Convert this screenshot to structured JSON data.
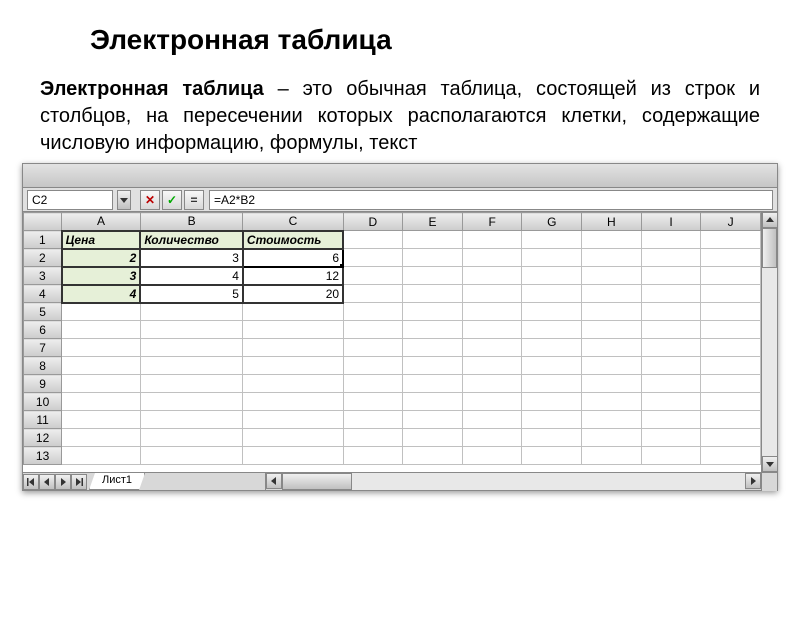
{
  "title": "Электронная таблица",
  "intro_bold": "Электронная таблица",
  "intro_rest": " – это обычная таблица, состоящей из строк и столбцов, на пересечении которых располагаются клетки, содержащие числовую информацию, формулы, текст",
  "formula_bar": {
    "cell_ref": "C2",
    "formula": "=A2*B2"
  },
  "columns": [
    "A",
    "B",
    "C",
    "D",
    "E",
    "F",
    "G",
    "H",
    "I",
    "J"
  ],
  "rows": [
    "1",
    "2",
    "3",
    "4",
    "5",
    "6",
    "7",
    "8",
    "9",
    "10",
    "11",
    "12",
    "13"
  ],
  "headers": {
    "A": "Цена",
    "B": "Количество",
    "C": "Стоимость"
  },
  "data": {
    "r2": {
      "A": "2",
      "B": "3",
      "C": "6"
    },
    "r3": {
      "A": "3",
      "B": "4",
      "C": "12"
    },
    "r4": {
      "A": "4",
      "B": "5",
      "C": "20"
    }
  },
  "sheet_tab": "Лист1",
  "active_cell": "C2"
}
